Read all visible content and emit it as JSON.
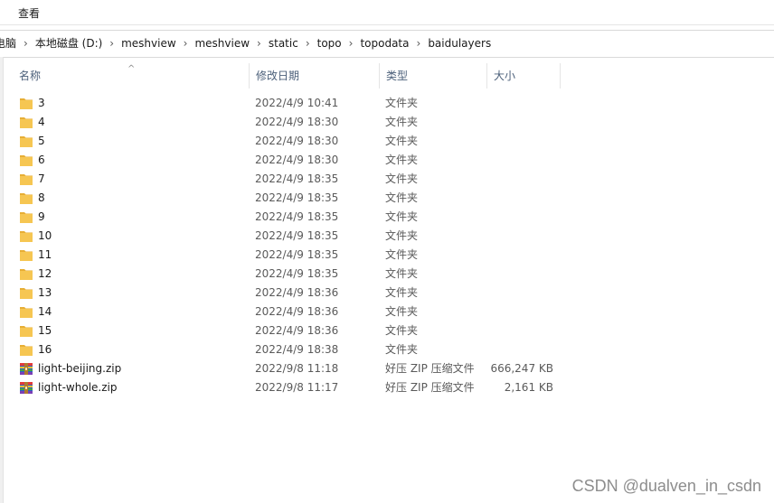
{
  "ribbon": {
    "view_tab": "查看"
  },
  "breadcrumb": [
    "电脑",
    "本地磁盘 (D:)",
    "meshview",
    "meshview",
    "static",
    "topo",
    "topodata",
    "baidulayers"
  ],
  "columns": {
    "name": "名称",
    "modified": "修改日期",
    "type": "类型",
    "size": "大小"
  },
  "files": [
    {
      "name": "3",
      "modified": "2022/4/9 10:41",
      "type": "文件夹",
      "size": "",
      "icon": "folder-icon"
    },
    {
      "name": "4",
      "modified": "2022/4/9 18:30",
      "type": "文件夹",
      "size": "",
      "icon": "folder-icon"
    },
    {
      "name": "5",
      "modified": "2022/4/9 18:30",
      "type": "文件夹",
      "size": "",
      "icon": "folder-icon"
    },
    {
      "name": "6",
      "modified": "2022/4/9 18:30",
      "type": "文件夹",
      "size": "",
      "icon": "folder-icon"
    },
    {
      "name": "7",
      "modified": "2022/4/9 18:35",
      "type": "文件夹",
      "size": "",
      "icon": "folder-icon"
    },
    {
      "name": "8",
      "modified": "2022/4/9 18:35",
      "type": "文件夹",
      "size": "",
      "icon": "folder-icon"
    },
    {
      "name": "9",
      "modified": "2022/4/9 18:35",
      "type": "文件夹",
      "size": "",
      "icon": "folder-icon"
    },
    {
      "name": "10",
      "modified": "2022/4/9 18:35",
      "type": "文件夹",
      "size": "",
      "icon": "folder-icon"
    },
    {
      "name": "11",
      "modified": "2022/4/9 18:35",
      "type": "文件夹",
      "size": "",
      "icon": "folder-icon"
    },
    {
      "name": "12",
      "modified": "2022/4/9 18:35",
      "type": "文件夹",
      "size": "",
      "icon": "folder-icon"
    },
    {
      "name": "13",
      "modified": "2022/4/9 18:36",
      "type": "文件夹",
      "size": "",
      "icon": "folder-icon"
    },
    {
      "name": "14",
      "modified": "2022/4/9 18:36",
      "type": "文件夹",
      "size": "",
      "icon": "folder-icon"
    },
    {
      "name": "15",
      "modified": "2022/4/9 18:36",
      "type": "文件夹",
      "size": "",
      "icon": "folder-icon"
    },
    {
      "name": "16",
      "modified": "2022/4/9 18:38",
      "type": "文件夹",
      "size": "",
      "icon": "folder-icon"
    },
    {
      "name": "light-beijing.zip",
      "modified": "2022/9/8 11:18",
      "type": "好压 ZIP 压缩文件",
      "size": "666,247 KB",
      "icon": "zip-archive-icon"
    },
    {
      "name": "light-whole.zip",
      "modified": "2022/9/8 11:17",
      "type": "好压 ZIP 压缩文件",
      "size": "2,161 KB",
      "icon": "zip-archive-icon"
    }
  ],
  "watermark": "CSDN @dualven_in_csdn",
  "colors": {
    "folder": "#f6c652",
    "folder_tab": "#e7ae35",
    "header_text": "#4c607a",
    "muted_text": "#5a5a5a"
  }
}
